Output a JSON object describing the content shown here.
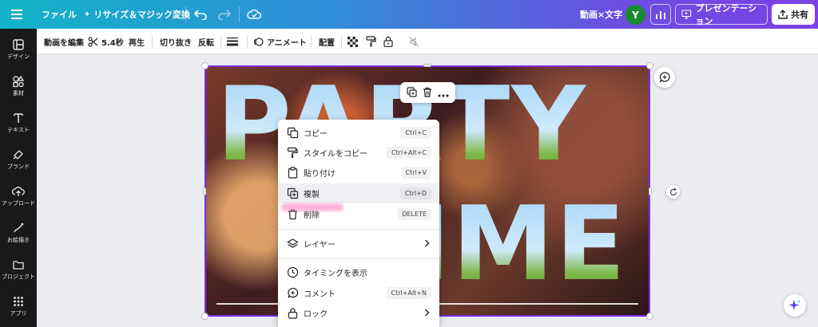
{
  "topbar": {
    "file_label": "ファイル",
    "resize_label": "リサイズ＆マジック変換",
    "doc_title": "動画×文字",
    "avatar_initial": "Y",
    "present_label": "プレゼンテーション",
    "share_label": "共有"
  },
  "sidebar": {
    "items": [
      {
        "label": "デザイン",
        "icon": "layout-icon"
      },
      {
        "label": "素材",
        "icon": "shapes-icon"
      },
      {
        "label": "テキスト",
        "icon": "text-icon"
      },
      {
        "label": "ブランド",
        "icon": "brand-icon"
      },
      {
        "label": "アップロード",
        "icon": "upload-icon"
      },
      {
        "label": "お絵描き",
        "icon": "draw-icon"
      },
      {
        "label": "プロジェクト",
        "icon": "folder-icon"
      },
      {
        "label": "アプリ",
        "icon": "apps-icon"
      }
    ]
  },
  "toolbar": {
    "edit_video": "動画を編集",
    "duration": "5.4秒",
    "play": "再生",
    "crop": "切り抜き",
    "flip": "反転",
    "animate": "アニメート",
    "position": "配置"
  },
  "canvas": {
    "line1": "PARTY",
    "line2": "TIME"
  },
  "context_menu": {
    "items": [
      {
        "label": "コピー",
        "shortcut": "Ctrl+C",
        "icon": "copy-icon"
      },
      {
        "label": "スタイルをコピー",
        "shortcut": "Ctrl+Alt+C",
        "icon": "paint-roller-icon"
      },
      {
        "label": "貼り付け",
        "shortcut": "Ctrl+V",
        "icon": "clipboard-icon"
      },
      {
        "label": "複製",
        "shortcut": "Ctrl+D",
        "icon": "duplicate-icon"
      },
      {
        "label": "削除",
        "shortcut": "DELETE",
        "icon": "trash-icon"
      },
      {
        "label": "レイヤー",
        "icon": "layers-icon"
      },
      {
        "label": "タイミングを表示",
        "icon": "clock-icon"
      },
      {
        "label": "コメント",
        "shortcut": "Ctrl+Alt+N",
        "icon": "comment-icon"
      },
      {
        "label": "ロック",
        "icon": "lock-icon"
      }
    ]
  },
  "colors": {
    "accent": "#7d2ae8",
    "topbar_start": "#12b3c7",
    "topbar_end": "#7c3fe6",
    "sidebar_bg": "#18191b"
  }
}
